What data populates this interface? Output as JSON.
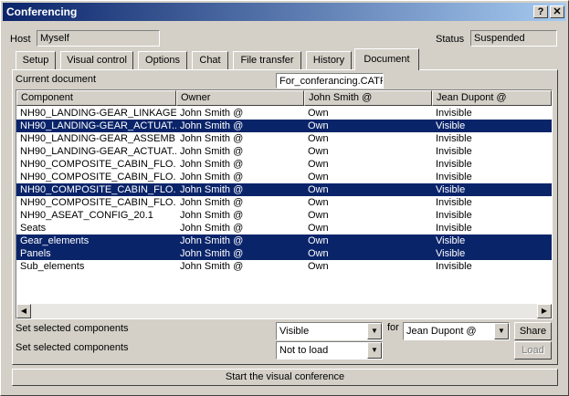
{
  "window": {
    "title": "Conferencing",
    "help_label": "?",
    "close_label": "✕"
  },
  "host": {
    "label": "Host",
    "value": "Myself"
  },
  "status": {
    "label": "Status",
    "value": "Suspended"
  },
  "tabs": [
    {
      "label": "Setup"
    },
    {
      "label": "Visual control"
    },
    {
      "label": "Options"
    },
    {
      "label": "Chat"
    },
    {
      "label": "File transfer"
    },
    {
      "label": "History"
    },
    {
      "label": "Document",
      "active": true
    }
  ],
  "document": {
    "label": "Current document",
    "value": "For_conferancing.CATP"
  },
  "table": {
    "columns": [
      "Component",
      "Owner",
      "John Smith @",
      "Jean Dupont @"
    ],
    "rows": [
      {
        "component": "NH90_LANDING-GEAR_LINKAGE...",
        "owner": "John Smith @",
        "john": "Own",
        "jean": "Invisible",
        "selected": false
      },
      {
        "component": "NH90_LANDING-GEAR_ACTUAT...",
        "owner": "John Smith @",
        "john": "Own",
        "jean": "Visible",
        "selected": true
      },
      {
        "component": "NH90_LANDING-GEAR_ASSEMB...",
        "owner": "John Smith @",
        "john": "Own",
        "jean": "Invisible",
        "selected": false
      },
      {
        "component": "NH90_LANDING-GEAR_ACTUAT...",
        "owner": "John Smith @",
        "john": "Own",
        "jean": "Invisible",
        "selected": false
      },
      {
        "component": "NH90_COMPOSITE_CABIN_FLO...",
        "owner": "John Smith @",
        "john": "Own",
        "jean": "Invisible",
        "selected": false
      },
      {
        "component": "NH90_COMPOSITE_CABIN_FLO...",
        "owner": "John Smith @",
        "john": "Own",
        "jean": "Invisible",
        "selected": false
      },
      {
        "component": "NH90_COMPOSITE_CABIN_FLO...",
        "owner": "John Smith @",
        "john": "Own",
        "jean": "Visible",
        "selected": true
      },
      {
        "component": "NH90_COMPOSITE_CABIN_FLO...",
        "owner": "John Smith @",
        "john": "Own",
        "jean": "Invisible",
        "selected": false
      },
      {
        "component": "NH90_ASEAT_CONFIG_20.1",
        "owner": "John Smith @",
        "john": "Own",
        "jean": "Invisible",
        "selected": false
      },
      {
        "component": "Seats",
        "owner": "John Smith @",
        "john": "Own",
        "jean": "Invisible",
        "selected": false
      },
      {
        "component": "Gear_elements",
        "owner": "John Smith @",
        "john": "Own",
        "jean": "Visible",
        "selected": true
      },
      {
        "component": "Panels",
        "owner": "John Smith @",
        "john": "Own",
        "jean": "Visible",
        "selected": true
      },
      {
        "component": "Sub_elements",
        "owner": "John Smith @",
        "john": "Own",
        "jean": "Invisible",
        "selected": false
      }
    ]
  },
  "controls": {
    "set_label_1": "Set selected components",
    "set_label_2": "Set selected components",
    "visibility_value": "Visible",
    "load_value": "Not to load",
    "for_label": "for",
    "user_value": "Jean Dupont @",
    "share_label": "Share",
    "load_label": "Load",
    "start_label": "Start the visual conference"
  },
  "colors": {
    "selection": "#0a246a",
    "title_gradient_start": "#0a246a",
    "title_gradient_end": "#a6caf0",
    "face": "#d4d0c8"
  }
}
